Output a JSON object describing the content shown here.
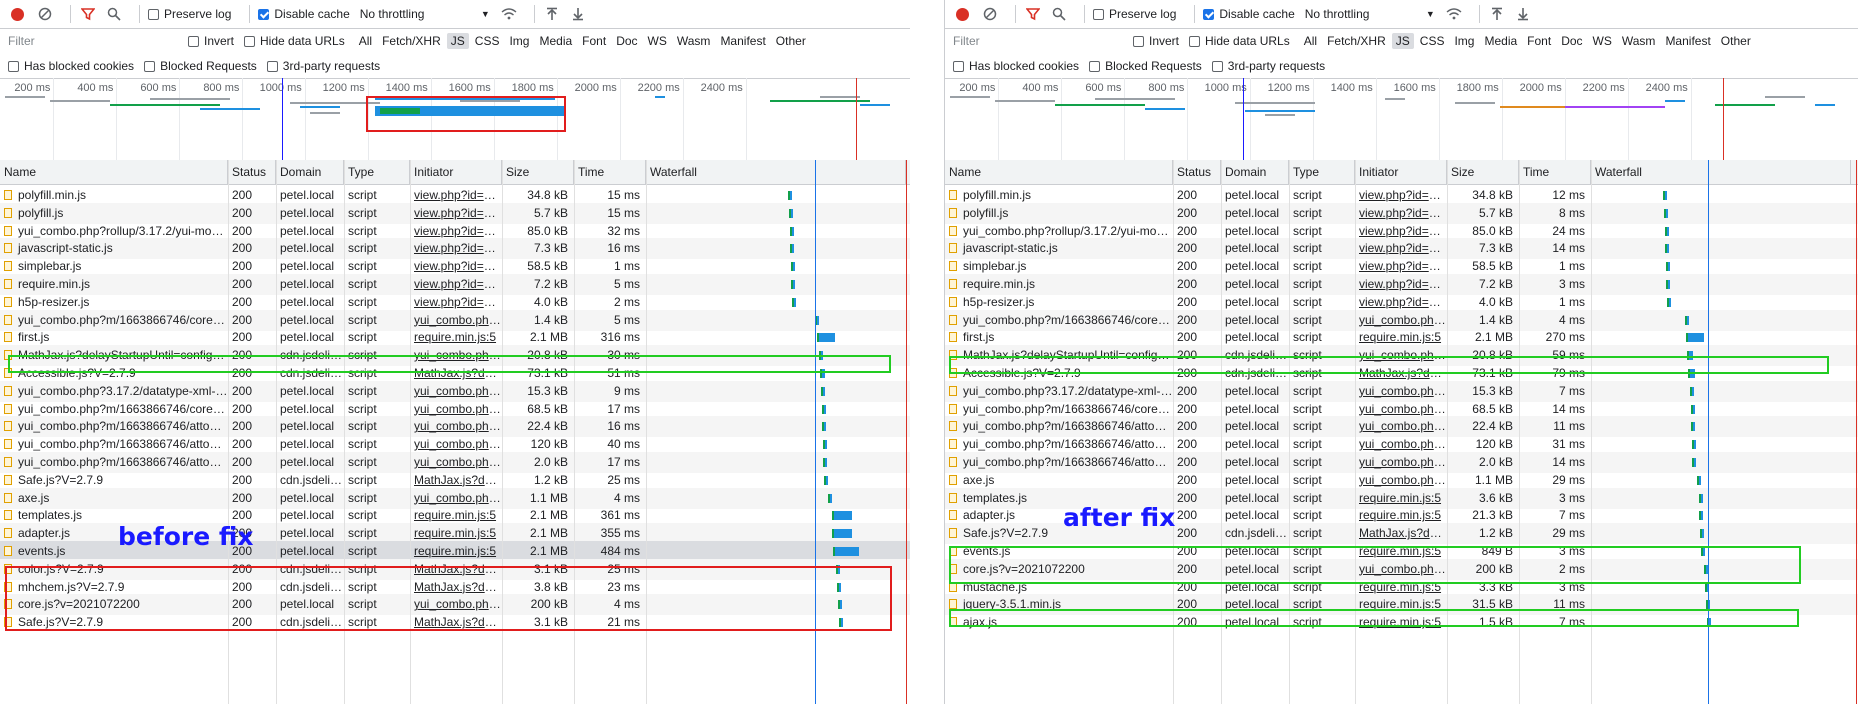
{
  "toolbar": {
    "preserve_log": "Preserve log",
    "disable_cache": "Disable cache",
    "throttling": "No throttling"
  },
  "filter": {
    "placeholder": "Filter",
    "invert": "Invert",
    "hide_data_urls": "Hide data URLs",
    "types": [
      "All",
      "Fetch/XHR",
      "JS",
      "CSS",
      "Img",
      "Media",
      "Font",
      "Doc",
      "WS",
      "Wasm",
      "Manifest",
      "Other"
    ],
    "active_type": "JS",
    "has_blocked_cookies": "Has blocked cookies",
    "blocked_requests": "Blocked Requests",
    "third_party": "3rd-party requests"
  },
  "overview_ticks": [
    "200 ms",
    "400 ms",
    "600 ms",
    "800 ms",
    "1000 ms",
    "1200 ms",
    "1400 ms",
    "1600 ms",
    "1800 ms",
    "2000 ms",
    "2200 ms",
    "2400 ms"
  ],
  "columns": [
    "Name",
    "Status",
    "Domain",
    "Type",
    "Initiator",
    "Size",
    "Time",
    "Waterfall"
  ],
  "colors": {
    "accent": "#1a73e8",
    "record": "#d93025",
    "highlight_red": "#e11d1d",
    "highlight_green": "#22cc22",
    "annotation": "#1a1aff",
    "js_bar": "#1e90e0"
  },
  "left": {
    "annotation": "before fix",
    "rows": [
      {
        "name": "polyfill.min.js",
        "status": "200",
        "domain": "petel.local",
        "type": "script",
        "initiator": "view.php?id=305",
        "size": "34.8 kB",
        "time": "15 ms"
      },
      {
        "name": "polyfill.js",
        "status": "200",
        "domain": "petel.local",
        "type": "script",
        "initiator": "view.php?id=305",
        "size": "5.7 kB",
        "time": "15 ms"
      },
      {
        "name": "yui_combo.php?rollup/3.17.2/yui-moodlesimple...",
        "status": "200",
        "domain": "petel.local",
        "type": "script",
        "initiator": "view.php?id=305",
        "size": "85.0 kB",
        "time": "32 ms"
      },
      {
        "name": "javascript-static.js",
        "status": "200",
        "domain": "petel.local",
        "type": "script",
        "initiator": "view.php?id=305",
        "size": "7.3 kB",
        "time": "16 ms"
      },
      {
        "name": "simplebar.js",
        "status": "200",
        "domain": "petel.local",
        "type": "script",
        "initiator": "view.php?id=305",
        "size": "58.5 kB",
        "time": "1 ms"
      },
      {
        "name": "require.min.js",
        "status": "200",
        "domain": "petel.local",
        "type": "script",
        "initiator": "view.php?id=305",
        "size": "7.2 kB",
        "time": "5 ms"
      },
      {
        "name": "h5p-resizer.js",
        "status": "200",
        "domain": "petel.local",
        "type": "script",
        "initiator": "view.php?id=305",
        "size": "4.0 kB",
        "time": "2 ms"
      },
      {
        "name": "yui_combo.php?m/1663866746/core/event...",
        "status": "200",
        "domain": "petel.local",
        "type": "script",
        "initiator": "yui_combo.php?r...",
        "size": "1.4 kB",
        "time": "5 ms"
      },
      {
        "name": "first.js",
        "status": "200",
        "domain": "petel.local",
        "type": "script",
        "initiator": "require.min.js:5",
        "size": "2.1 MB",
        "time": "316 ms"
      },
      {
        "name": "MathJax.js?delayStartupUntil=configured",
        "status": "200",
        "domain": "cdn.jsdelivr...",
        "type": "script",
        "initiator": "yui_combo.php?r...",
        "size": "20.8 kB",
        "time": "30 ms"
      },
      {
        "name": "Accessible.js?V=2.7.9",
        "status": "200",
        "domain": "cdn.jsdelivr...",
        "type": "script",
        "initiator": "MathJax.js?dela...",
        "size": "73.1 kB",
        "time": "51 ms"
      },
      {
        "name": "yui_combo.php?3.17.2/datatype-xml-parse...",
        "status": "200",
        "domain": "petel.local",
        "type": "script",
        "initiator": "yui_combo.php?r...",
        "size": "15.3 kB",
        "time": "9 ms"
      },
      {
        "name": "yui_combo.php?m/1663866746/core/noti...",
        "status": "200",
        "domain": "petel.local",
        "type": "script",
        "initiator": "yui_combo.php?r...",
        "size": "68.5 kB",
        "time": "17 ms"
      },
      {
        "name": "yui_combo.php?m/1663866746/atto_orde...",
        "status": "200",
        "domain": "petel.local",
        "type": "script",
        "initiator": "yui_combo.php?r...",
        "size": "22.4 kB",
        "time": "16 ms"
      },
      {
        "name": "yui_combo.php?m/1663866746/atto_sup...",
        "status": "200",
        "domain": "petel.local",
        "type": "script",
        "initiator": "yui_combo.php?r...",
        "size": "120 kB",
        "time": "40 ms"
      },
      {
        "name": "yui_combo.php?m/1663866746/atto_wiri...",
        "status": "200",
        "domain": "petel.local",
        "type": "script",
        "initiator": "yui_combo.php?r...",
        "size": "2.0 kB",
        "time": "17 ms"
      },
      {
        "name": "Safe.js?V=2.7.9",
        "status": "200",
        "domain": "cdn.jsdelivr...",
        "type": "script",
        "initiator": "MathJax.js?dela...",
        "size": "1.2 kB",
        "time": "25 ms"
      },
      {
        "name": "axe.js",
        "status": "200",
        "domain": "petel.local",
        "type": "script",
        "initiator": "yui_combo.php?r...",
        "size": "1.1 MB",
        "time": "4 ms"
      },
      {
        "name": "templates.js",
        "status": "200",
        "domain": "petel.local",
        "type": "script",
        "initiator": "require.min.js:5",
        "size": "2.1 MB",
        "time": "361 ms"
      },
      {
        "name": "adapter.js",
        "status": "200",
        "domain": "petel.local",
        "type": "script",
        "initiator": "require.min.js:5",
        "size": "2.1 MB",
        "time": "355 ms"
      },
      {
        "name": "events.js",
        "status": "200",
        "domain": "petel.local",
        "type": "script",
        "initiator": "require.min.js:5",
        "size": "2.1 MB",
        "time": "484 ms"
      },
      {
        "name": "color.js?V=2.7.9",
        "status": "200",
        "domain": "cdn.jsdelivr...",
        "type": "script",
        "initiator": "MathJax.js?dela...",
        "size": "3.1 kB",
        "time": "25 ms"
      },
      {
        "name": "mhchem.js?V=2.7.9",
        "status": "200",
        "domain": "cdn.jsdelivr...",
        "type": "script",
        "initiator": "MathJax.js?dela...",
        "size": "3.8 kB",
        "time": "23 ms"
      },
      {
        "name": "core.js?v=2021072200",
        "status": "200",
        "domain": "petel.local",
        "type": "script",
        "initiator": "yui_combo.php?r...",
        "size": "200 kB",
        "time": "4 ms"
      },
      {
        "name": "Safe.js?V=2.7.9",
        "status": "200",
        "domain": "cdn.jsdelivr...",
        "type": "script",
        "initiator": "MathJax.js?dela...",
        "size": "3.1 kB",
        "time": "21 ms"
      }
    ]
  },
  "right": {
    "annotation": "after fix",
    "rows": [
      {
        "name": "polyfill.min.js",
        "status": "200",
        "domain": "petel.local",
        "type": "script",
        "initiator": "view.php?id=305",
        "size": "34.8 kB",
        "time": "12 ms"
      },
      {
        "name": "polyfill.js",
        "status": "200",
        "domain": "petel.local",
        "type": "script",
        "initiator": "view.php?id=305",
        "size": "5.7 kB",
        "time": "8 ms"
      },
      {
        "name": "yui_combo.php?rollup/3.17.2/yui-moodlesimple...",
        "status": "200",
        "domain": "petel.local",
        "type": "script",
        "initiator": "view.php?id=305",
        "size": "85.0 kB",
        "time": "24 ms"
      },
      {
        "name": "javascript-static.js",
        "status": "200",
        "domain": "petel.local",
        "type": "script",
        "initiator": "view.php?id=305",
        "size": "7.3 kB",
        "time": "14 ms"
      },
      {
        "name": "simplebar.js",
        "status": "200",
        "domain": "petel.local",
        "type": "script",
        "initiator": "view.php?id=305",
        "size": "58.5 kB",
        "time": "1 ms"
      },
      {
        "name": "require.min.js",
        "status": "200",
        "domain": "petel.local",
        "type": "script",
        "initiator": "view.php?id=305",
        "size": "7.2 kB",
        "time": "3 ms"
      },
      {
        "name": "h5p-resizer.js",
        "status": "200",
        "domain": "petel.local",
        "type": "script",
        "initiator": "view.php?id=305",
        "size": "4.0 kB",
        "time": "1 ms"
      },
      {
        "name": "yui_combo.php?m/1663866746/core/event...",
        "status": "200",
        "domain": "petel.local",
        "type": "script",
        "initiator": "yui_combo.php?r...",
        "size": "1.4 kB",
        "time": "4 ms"
      },
      {
        "name": "first.js",
        "status": "200",
        "domain": "petel.local",
        "type": "script",
        "initiator": "require.min.js:5",
        "size": "2.1 MB",
        "time": "270 ms"
      },
      {
        "name": "MathJax.js?delayStartupUntil=configured",
        "status": "200",
        "domain": "cdn.jsdelivr...",
        "type": "script",
        "initiator": "yui_combo.php?r...",
        "size": "20.8 kB",
        "time": "59 ms"
      },
      {
        "name": "Accessible.js?V=2.7.9",
        "status": "200",
        "domain": "cdn.jsdelivr...",
        "type": "script",
        "initiator": "MathJax.js?dela...",
        "size": "73.1 kB",
        "time": "79 ms"
      },
      {
        "name": "yui_combo.php?3.17.2/datatype-xml-parse...",
        "status": "200",
        "domain": "petel.local",
        "type": "script",
        "initiator": "yui_combo.php?r...",
        "size": "15.3 kB",
        "time": "7 ms"
      },
      {
        "name": "yui_combo.php?m/1663866746/core/noti...",
        "status": "200",
        "domain": "petel.local",
        "type": "script",
        "initiator": "yui_combo.php?r...",
        "size": "68.5 kB",
        "time": "14 ms"
      },
      {
        "name": "yui_combo.php?m/1663866746/atto_orde...",
        "status": "200",
        "domain": "petel.local",
        "type": "script",
        "initiator": "yui_combo.php?r...",
        "size": "22.4 kB",
        "time": "11 ms"
      },
      {
        "name": "yui_combo.php?m/1663866746/atto_sup...",
        "status": "200",
        "domain": "petel.local",
        "type": "script",
        "initiator": "yui_combo.php?r...",
        "size": "120 kB",
        "time": "31 ms"
      },
      {
        "name": "yui_combo.php?m/1663866746/atto_wiri...",
        "status": "200",
        "domain": "petel.local",
        "type": "script",
        "initiator": "yui_combo.php?r...",
        "size": "2.0 kB",
        "time": "14 ms"
      },
      {
        "name": "axe.js",
        "status": "200",
        "domain": "petel.local",
        "type": "script",
        "initiator": "yui_combo.php?r...",
        "size": "1.1 MB",
        "time": "29 ms"
      },
      {
        "name": "templates.js",
        "status": "200",
        "domain": "petel.local",
        "type": "script",
        "initiator": "require.min.js:5",
        "size": "3.6 kB",
        "time": "3 ms"
      },
      {
        "name": "adapter.js",
        "status": "200",
        "domain": "petel.local",
        "type": "script",
        "initiator": "require.min.js:5",
        "size": "21.3 kB",
        "time": "7 ms"
      },
      {
        "name": "Safe.js?V=2.7.9",
        "status": "200",
        "domain": "cdn.jsdelivr...",
        "type": "script",
        "initiator": "MathJax.js?dela...",
        "size": "1.2 kB",
        "time": "29 ms"
      },
      {
        "name": "events.js",
        "status": "200",
        "domain": "petel.local",
        "type": "script",
        "initiator": "require.min.js:5",
        "size": "849 B",
        "time": "3 ms"
      },
      {
        "name": "core.js?v=2021072200",
        "status": "200",
        "domain": "petel.local",
        "type": "script",
        "initiator": "yui_combo.php?r...",
        "size": "200 kB",
        "time": "2 ms"
      },
      {
        "name": "mustache.js",
        "status": "200",
        "domain": "petel.local",
        "type": "script",
        "initiator": "require.min.js:5",
        "size": "3.3 kB",
        "time": "3 ms"
      },
      {
        "name": "jquery-3.5.1.min.js",
        "status": "200",
        "domain": "petel.local",
        "type": "script",
        "initiator": "require.min.js:5",
        "size": "31.5 kB",
        "time": "11 ms"
      },
      {
        "name": "ajax.js",
        "status": "200",
        "domain": "petel.local",
        "type": "script",
        "initiator": "require.min.js:5",
        "size": "1.5 kB",
        "time": "7 ms"
      }
    ]
  }
}
